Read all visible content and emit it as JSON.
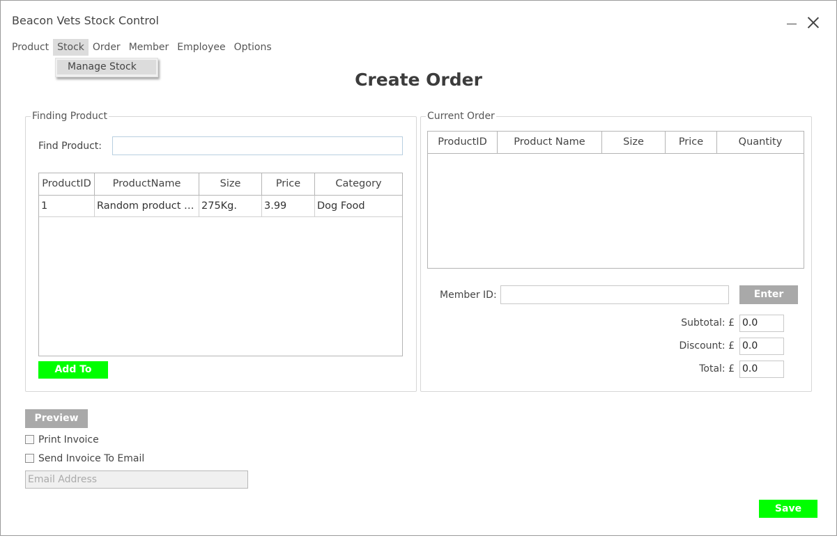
{
  "window": {
    "title": "Beacon Vets Stock Control"
  },
  "menu": {
    "items": [
      "Product",
      "Stock",
      "Order",
      "Member",
      "Employee",
      "Options"
    ],
    "active": "Stock",
    "dropdown": [
      "Manage Stock"
    ]
  },
  "page": {
    "title": "Create Order"
  },
  "finding": {
    "legend": "Finding Product",
    "find_label": "Find Product:",
    "find_value": "",
    "columns": [
      "ProductID",
      "ProductName",
      "Size",
      "Price",
      "Category"
    ],
    "rows": [
      [
        "1",
        "Random product name",
        "275Kg.",
        "3.99",
        "Dog Food"
      ]
    ],
    "add_button": "Add To Order"
  },
  "order": {
    "legend": "Current Order",
    "columns": [
      "ProductID",
      "Product Name",
      "Size",
      "Price",
      "Quantity"
    ],
    "rows": [],
    "member_label": "Member ID:",
    "member_value": "",
    "enter_button": "Enter",
    "subtotal_label": "Subtotal: £",
    "subtotal": "0.0",
    "discount_label": "Discount: £",
    "discount": "0.0",
    "total_label": "Total: £",
    "total": "0.0"
  },
  "bottom": {
    "preview_button": "Preview",
    "print_invoice": "Print Invoice",
    "send_email": "Send Invoice To Email",
    "email_placeholder": "Email Address",
    "save_button": "Save"
  },
  "colors": {
    "accent_green": "#00ff00",
    "button_grey": "#a9a9a9"
  }
}
